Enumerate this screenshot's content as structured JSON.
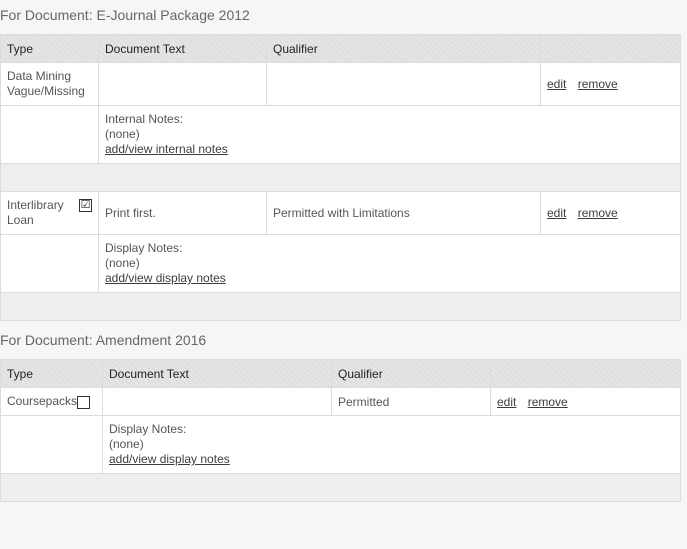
{
  "doc1": {
    "heading": "For Document: E-Journal Package 2012",
    "headers": {
      "type": "Type",
      "text": "Document Text",
      "qualifier": "Qualifier"
    },
    "row1": {
      "type_line1": "Data Mining",
      "type_line2": "Vague/Missing",
      "doc_text": "",
      "qualifier": "",
      "edit": "edit",
      "remove": "remove",
      "notes_label": "Internal Notes:",
      "notes_value": "(none)",
      "notes_link": "add/view internal notes"
    },
    "row2": {
      "type_line1": "Interlibrary",
      "type_line2": "Loan",
      "checkbox": "☑",
      "doc_text": "Print first.",
      "qualifier": "Permitted with Limitations",
      "edit": "edit",
      "remove": "remove",
      "notes_label": "Display Notes:",
      "notes_value": "(none)",
      "notes_link": "add/view display notes"
    }
  },
  "doc2": {
    "heading": "For Document: Amendment 2016",
    "headers": {
      "type": "Type",
      "text": "Document Text",
      "qualifier": "Qualifier"
    },
    "row1": {
      "type_line1": "Coursepacks",
      "checkbox": "",
      "doc_text": "",
      "qualifier": "Permitted",
      "edit": "edit",
      "remove": "remove",
      "notes_label": "Display Notes:",
      "notes_value": "(none)",
      "notes_link": "add/view display notes"
    }
  }
}
